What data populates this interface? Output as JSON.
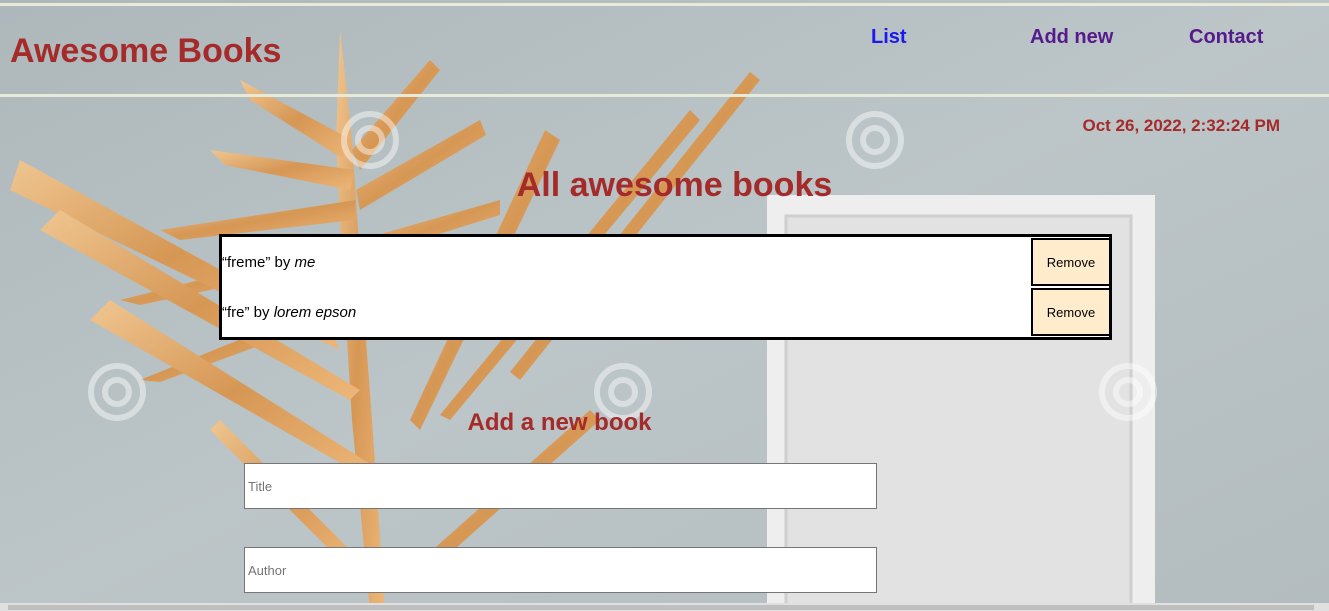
{
  "header": {
    "brand": "Awesome Books",
    "nav": [
      {
        "label": "List"
      },
      {
        "label": "Add new"
      },
      {
        "label": "Contact"
      }
    ]
  },
  "date": "Oct 26, 2022, 2:32:24 PM",
  "list_section": {
    "title": "All awesome books",
    "books": [
      {
        "title_quoted": "“freme”",
        "by": "by",
        "author": "me",
        "remove_label": "Remove"
      },
      {
        "title_quoted": "“fre”",
        "by": "by",
        "author": "lorem epson",
        "remove_label": "Remove"
      }
    ]
  },
  "form_section": {
    "title": "Add a new book",
    "title_placeholder": "Title",
    "author_placeholder": "Author"
  },
  "colors": {
    "accent": "#a52a2a",
    "link": "#1a1aee",
    "visited_link": "#551a8b",
    "button_bg": "#ffeccd",
    "background": "#b7c0c3"
  }
}
